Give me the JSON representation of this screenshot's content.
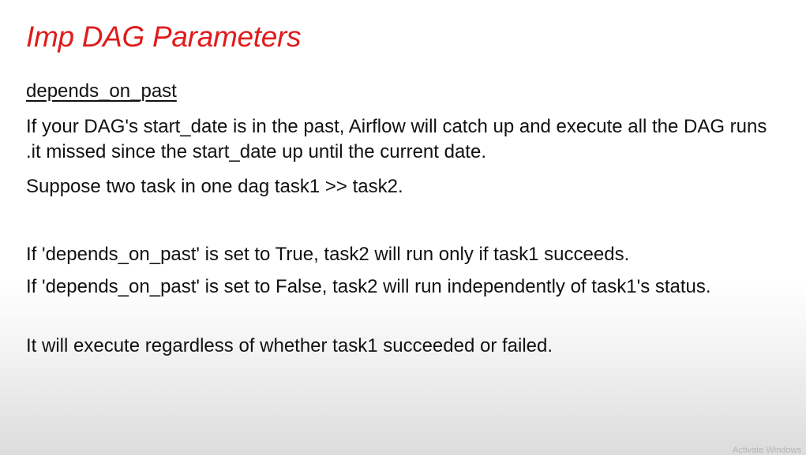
{
  "slide": {
    "title": "Imp DAG Parameters",
    "subheading": "depends_on_past",
    "paragraphs": [
      "If your DAG's start_date is in the past, Airflow will catch up and execute all the DAG runs .it missed since the start_date up until the current date.",
      "Suppose two task in one dag task1 >> task2.",
      "If 'depends_on_past' is set to True, task2 will run only if task1 succeeds.",
      "If 'depends_on_past' is set to False, task2 will run independently of task1's status.",
      "It will execute regardless of whether task1 succeeded or failed."
    ],
    "watermark": "Activate Windows"
  },
  "colors": {
    "title": "#e01b1b",
    "text": "#111111"
  }
}
